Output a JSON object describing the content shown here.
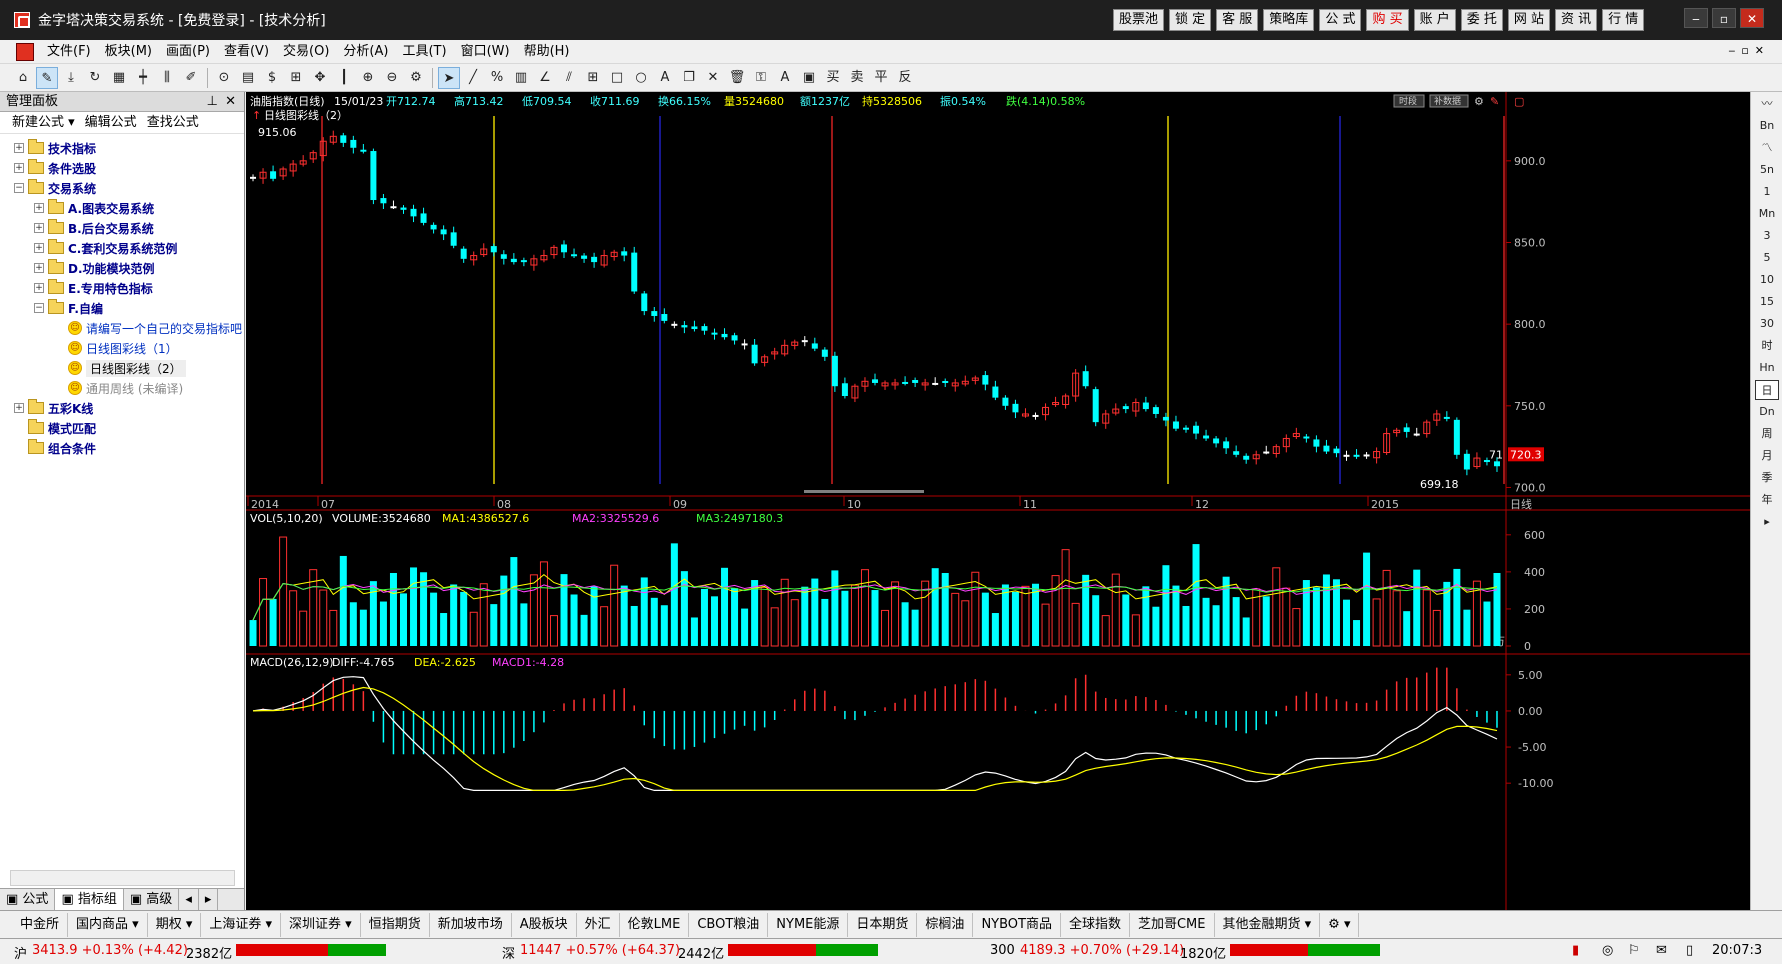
{
  "titlebar": {
    "title": "金字塔决策交易系统 - [免费登录] - [技术分析]",
    "buttons": [
      "股票池",
      "锁 定",
      "客 服",
      "策略库",
      "公 式",
      "购 买",
      "账 户",
      "委 托",
      "网 站",
      "资 讯",
      "行 情"
    ]
  },
  "menubar": {
    "items": [
      "文件(F)",
      "板块(M)",
      "画面(P)",
      "查看(V)",
      "交易(O)",
      "分析(A)",
      "工具(T)",
      "窗口(W)",
      "帮助(H)"
    ]
  },
  "toolbar": {
    "icons": [
      "home-icon",
      "draw-icon",
      "download-icon",
      "refresh-icon",
      "grid-icon",
      "candle-icon",
      "kline-icon",
      "edit-icon",
      "play-icon",
      "doc-icon",
      "dollar-icon",
      "calc-icon",
      "move-icon",
      "bar-icon",
      "zoom-in-icon",
      "zoom-out-icon",
      "gear-icon",
      "pointer-icon",
      "line-icon",
      "percent-icon",
      "ruler-icon",
      "angle-icon",
      "channel-icon",
      "table-icon",
      "rect-icon",
      "circle-icon",
      "text-a-icon",
      "copy-icon",
      "delete-icon",
      "trash-icon",
      "lock-icon",
      "color-icon",
      "save-icon",
      "buy-icon",
      "sell-icon",
      "flat-icon",
      "reverse-icon"
    ]
  },
  "leftpanel": {
    "header": "管理面板",
    "tools": [
      "新建公式 ▾",
      "编辑公式",
      "查找公式"
    ],
    "tree": [
      {
        "level": 0,
        "exp": "+",
        "type": "folder",
        "label": "技术指标"
      },
      {
        "level": 0,
        "exp": "+",
        "type": "folder",
        "label": "条件选股"
      },
      {
        "level": 0,
        "exp": "−",
        "type": "folder",
        "label": "交易系统"
      },
      {
        "level": 1,
        "exp": "+",
        "type": "folder",
        "label": "A.图表交易系统"
      },
      {
        "level": 1,
        "exp": "+",
        "type": "folder",
        "label": "B.后台交易系统"
      },
      {
        "level": 1,
        "exp": "+",
        "type": "folder",
        "label": "C.套利交易系统范例"
      },
      {
        "level": 1,
        "exp": "+",
        "type": "folder",
        "label": "D.功能模块范例"
      },
      {
        "level": 1,
        "exp": "+",
        "type": "folder",
        "label": "E.专用特色指标"
      },
      {
        "level": 1,
        "exp": "−",
        "type": "folder",
        "label": "F.自编"
      },
      {
        "level": 2,
        "exp": "",
        "type": "smile",
        "label": "请编写一个自己的交易指标吧",
        "style": "blue"
      },
      {
        "level": 2,
        "exp": "",
        "type": "smile",
        "label": "日线图彩线（1）",
        "style": "blue"
      },
      {
        "level": 2,
        "exp": "",
        "type": "smile",
        "label": "日线图彩线（2）",
        "style": "black"
      },
      {
        "level": 2,
        "exp": "",
        "type": "smile",
        "label": "通用周线 (未编译)",
        "style": "gray"
      },
      {
        "level": 0,
        "exp": "+",
        "type": "folder",
        "label": "五彩K线"
      },
      {
        "level": 0,
        "exp": "",
        "type": "folder",
        "label": "模式匹配"
      },
      {
        "level": 0,
        "exp": "",
        "type": "folder",
        "label": "组合条件"
      }
    ],
    "bottom_tabs": [
      "公式",
      "指标组",
      "高级"
    ]
  },
  "chart_header": {
    "name": "油脂指数(日线)",
    "date": "15/01/23",
    "open": "开712.74",
    "high": "高713.42",
    "low": "低709.54",
    "close": "收711.69",
    "turnover": "换66.15%",
    "volume": "量3524680",
    "amount": "额1237亿",
    "hold": "持5328506",
    "amp": "振0.54%",
    "change": "跌(4.14)0.58%",
    "sub": "日线图彩线（2）",
    "btn1": "时段",
    "btn2": "补数据"
  },
  "chart_data": {
    "type": "candlestick",
    "price_axis": {
      "ticks": [
        "900.0",
        "850.0",
        "800.0",
        "750.0",
        "700.0"
      ],
      "ylim": [
        696,
        925
      ]
    },
    "high_label": "915.06",
    "low_label": "699.18",
    "current_price": "720.3",
    "last_side": "71",
    "x_ticks": [
      "2014",
      "07",
      "08",
      "09",
      "10",
      "11",
      "12",
      "2015"
    ],
    "x_unit": "日线",
    "close_series": [
      890,
      893,
      889,
      895,
      898,
      900,
      905,
      912,
      915,
      911,
      908,
      906,
      876,
      874,
      872,
      870,
      866,
      862,
      858,
      855,
      848,
      840,
      842,
      846,
      844,
      840,
      838,
      838,
      840,
      842,
      847,
      844,
      842,
      840,
      838,
      842,
      844,
      842,
      820,
      808,
      805,
      802,
      800,
      798,
      797,
      796,
      794,
      792,
      790,
      788,
      776,
      780,
      783,
      787,
      789,
      790,
      785,
      780,
      762,
      756,
      762,
      765,
      764,
      764,
      764,
      764,
      764,
      764,
      764,
      764,
      764,
      765,
      767,
      763,
      755,
      750,
      746,
      745,
      744,
      749,
      752,
      756,
      770,
      762,
      740,
      745,
      748,
      748,
      752,
      748,
      745,
      741,
      736,
      736,
      733,
      730,
      727,
      724,
      720,
      717,
      720,
      722,
      725,
      730,
      733,
      730,
      725,
      722,
      721,
      720,
      719,
      720,
      722,
      733,
      735,
      734,
      733,
      740,
      745,
      742,
      720,
      711,
      718,
      716,
      713
    ],
    "vol": {
      "title": "VOL(5,10,20)",
      "volume": "VOLUME:3524680",
      "ma1": "MA1:4386527.6",
      "ma2": "MA2:3325529.6",
      "ma3": "MA3:2497180.3",
      "ticks": [
        "600",
        "400",
        "200",
        "0"
      ],
      "unit": "万",
      "ylim": [
        0,
        680
      ]
    },
    "macd": {
      "title": "MACD(26,12,9)",
      "diff": "DIFF:-4.765",
      "dea": "DEA:-2.625",
      "macd1": "MACD1:-4.28",
      "ticks": [
        "5.00",
        "0.00",
        "-5.00",
        "-10.00"
      ],
      "ylim": [
        -11.5,
        6.5
      ]
    },
    "colors": {
      "up": "#ff3030",
      "down": "#00ffff",
      "flat": "#ffffff",
      "ma1": "#ffff00",
      "ma2": "#ff40ff",
      "ma3": "#40ff40",
      "red_vline": "#d02020",
      "yellow_vline": "#e0d000",
      "blue_vline": "#2020c0"
    }
  },
  "righttool": [
    "〰",
    "Bn",
    "〽",
    "5n",
    "1",
    "Mn",
    "3",
    "5",
    "10",
    "15",
    "30",
    "时",
    "Hn",
    "日",
    "Dn",
    "周",
    "月",
    "季",
    "年",
    "▸"
  ],
  "bottomtabs": [
    "中金所",
    "国内商品 ▾",
    "期权 ▾",
    "上海证券 ▾",
    "深圳证券 ▾",
    "恒指期货",
    "新加坡市场",
    "A股板块",
    "外汇",
    "伦敦LME",
    "CBOT粮油",
    "NYME能源",
    "日本期货",
    "棕榈油",
    "NYBOT商品",
    "全球指数",
    "芝加哥CME",
    "其他金融期货 ▾"
  ],
  "statusbar": {
    "sh_label": "沪",
    "sh": "3413.9 +0.13% (+4.42)",
    "sh_amt": "2382亿",
    "sz_label": "深",
    "sz": "11447 +0.57% (+64.37)",
    "sz_amt": "2442亿",
    "x300_label": "300",
    "x300": "4189.3 +0.70% (+29.14)",
    "x300_amt": "1820亿",
    "time": "20:07:3"
  }
}
